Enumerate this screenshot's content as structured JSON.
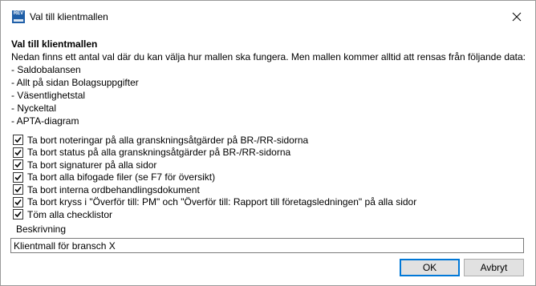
{
  "window": {
    "title": "Val till klientmallen",
    "app_icon_text": "REV"
  },
  "intro": {
    "heading": "Val till klientmallen",
    "text": "Nedan finns ett antal val där du kan välja hur mallen ska fungera. Men mallen kommer alltid att rensas från följande data:",
    "items": [
      "- Saldobalansen",
      "- Allt på sidan Bolagsuppgifter",
      "- Väsentlighetstal",
      "- Nyckeltal",
      "- APTA-diagram"
    ]
  },
  "options": [
    {
      "label": "Ta bort noteringar på alla granskningsåtgärder på BR-/RR-sidorna",
      "checked": true
    },
    {
      "label": "Ta bort status på alla granskningsåtgärder på BR-/RR-sidorna",
      "checked": true
    },
    {
      "label": "Ta bort signaturer på alla sidor",
      "checked": true
    },
    {
      "label": "Ta bort alla bifogade filer (se F7 för översikt)",
      "checked": true
    },
    {
      "label": "Ta bort interna ordbehandlingsdokument",
      "checked": true
    },
    {
      "label": "Ta bort kryss i \"Överför till: PM\" och \"Överför till: Rapport till företagsledningen\" på alla sidor",
      "checked": true
    },
    {
      "label": "Töm alla checklistor",
      "checked": true
    }
  ],
  "description": {
    "label": "Beskrivning",
    "value": "Klientmall för bransch X"
  },
  "buttons": {
    "ok": "OK",
    "cancel": "Avbryt"
  },
  "colors": {
    "accent": "#0078d7",
    "app_icon": "#1f5fa8"
  }
}
